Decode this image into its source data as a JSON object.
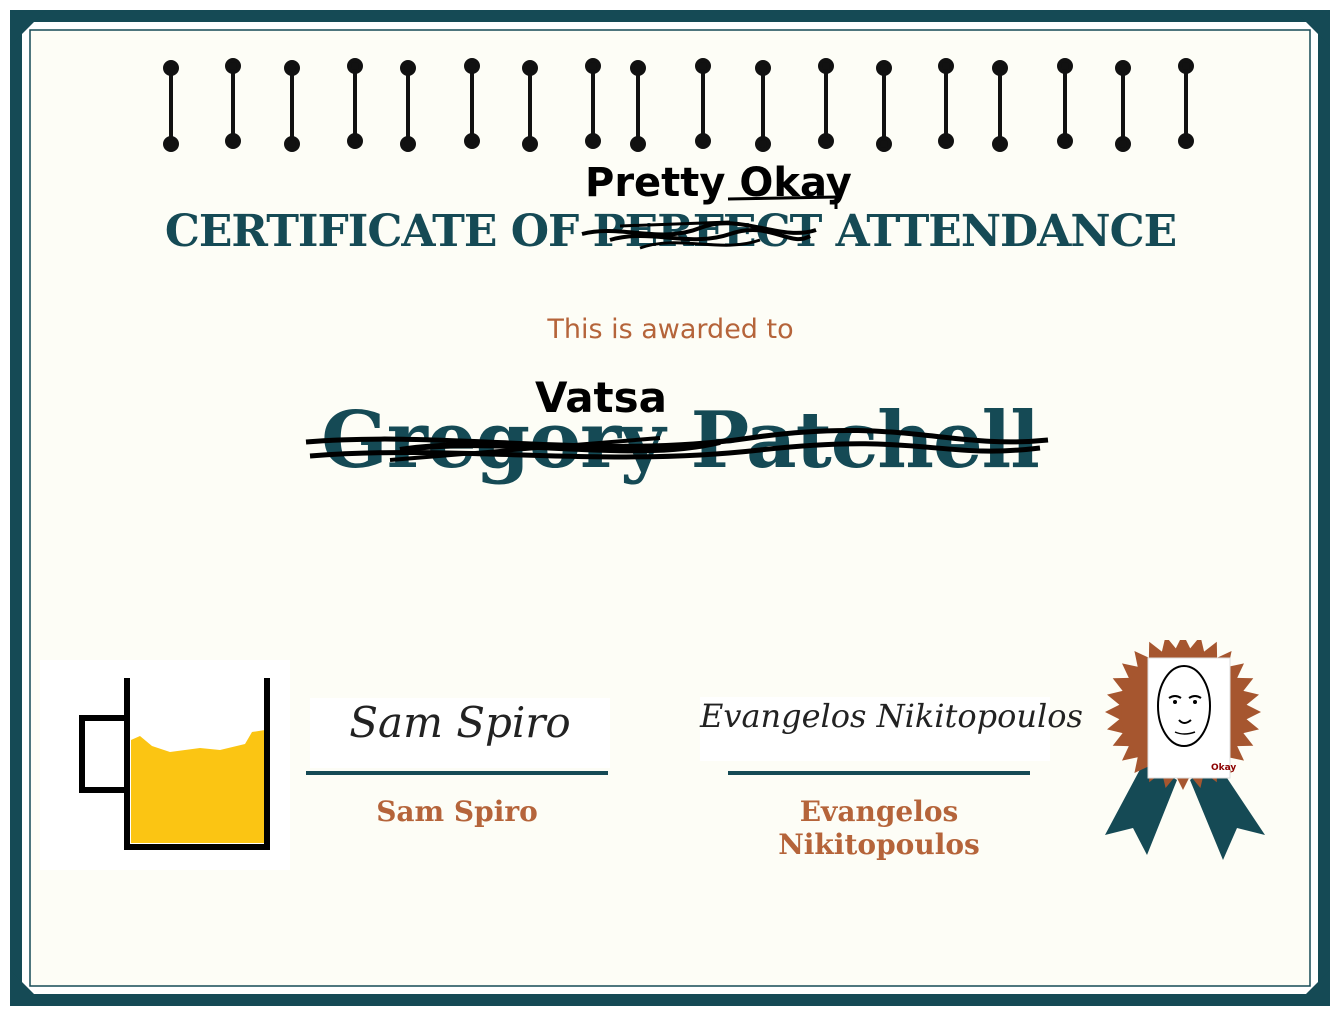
{
  "certificate": {
    "title_prefix": "CERTIFICATE OF",
    "title_struck_word": "PERFECT",
    "title_suffix": "ATTENDANCE",
    "title_overwrite": "Pretty Okay",
    "awarded_text": "This is awarded to",
    "original_name": "Gregory Patchell",
    "overwrite_name": "Vatsa"
  },
  "signatures": [
    {
      "script": "Sam Spiro",
      "printed": "Sam Spiro"
    },
    {
      "script": "Evangelos Nikitopoulos",
      "printed_line1": "Evangelos",
      "printed_line2": "Nikitopoulos"
    }
  ],
  "badge": {
    "caption": "Okay",
    "icon": "okay-face-icon"
  },
  "mug": {
    "icon": "beer-mug-icon"
  },
  "colors": {
    "teal": "#154a55",
    "copper": "#b5643a",
    "paper": "#fdfdf6",
    "beer": "#fbc513",
    "ribbon": "#154a55",
    "seal": "#a6562f"
  }
}
